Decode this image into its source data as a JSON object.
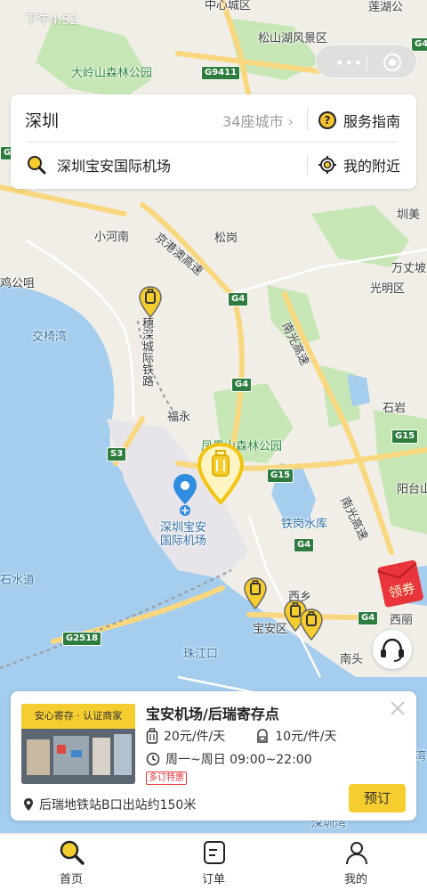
{
  "status": {
    "time": "下午4:52"
  },
  "map": {
    "labels": {
      "zhongxin": "中心城区",
      "lianhu": "莲湖公",
      "songshanhu": "松山湖风景区",
      "dalingshan": "大岭山森林公园",
      "xiaohenan": "小河南",
      "songgang": "松岗",
      "kanmei": "圳美",
      "wanzhang": "万丈坡",
      "guangming": "光明区",
      "gongzhou": "鸡公咀",
      "jiaoyiwan": "交椅湾",
      "nanguang": "南光高速",
      "fuyong": "福永",
      "shiyan": "石岩",
      "fenghuangshan": "凤凰山森林公园",
      "yangtai": "阳台山",
      "airport": "深圳宝安\n国际机场",
      "tiegang": "铁岗水库",
      "nanguang2": "南光高速",
      "shishuidao": "石水道",
      "xixiang": "西乡",
      "xili": "西丽",
      "baoan": "宝安区",
      "zhujiangkou": "珠江口",
      "nantou": "南头",
      "suishen": "穗深城际铁路",
      "jinggang": "京港澳高速",
      "shenzhenwan": "深圳湾",
      "wan": "湾"
    },
    "shields": {
      "g9411": "G9411",
      "g4a": "G4",
      "g4b": "G4",
      "g4c": "G4",
      "g4d": "G4",
      "g4e": "G4",
      "g4f": "G4",
      "s3": "S3",
      "g15a": "G15",
      "g15b": "G15",
      "g2518": "G2518"
    }
  },
  "capsule": {
    "more_icon": "more-dots-icon",
    "close_icon": "target-icon"
  },
  "search": {
    "city": "深圳",
    "city_count": "34座城市",
    "guide_label": "服务指南",
    "query": "深圳宝安国际机场",
    "nearby_label": "我的附近"
  },
  "coupon": {
    "label": "领券"
  },
  "store": {
    "badge": "安心寄存 · 认证商家",
    "name": "宝安机场/后瑞寄存点",
    "price_large": "20元/件/天",
    "price_small": "10元/件/天",
    "hours": "周一~周日 09:00~22:00",
    "promo": "多订特惠",
    "address": "后瑞地铁站B口出站约150米",
    "book_label": "预订"
  },
  "tabs": [
    {
      "label": "首页",
      "icon": "search-icon"
    },
    {
      "label": "订单",
      "icon": "order-icon"
    },
    {
      "label": "我的",
      "icon": "user-icon"
    }
  ],
  "colors": {
    "accent": "#f5cd2f",
    "promo": "#e2383b",
    "water": "#a4cdee",
    "park": "#c7e6b5"
  }
}
